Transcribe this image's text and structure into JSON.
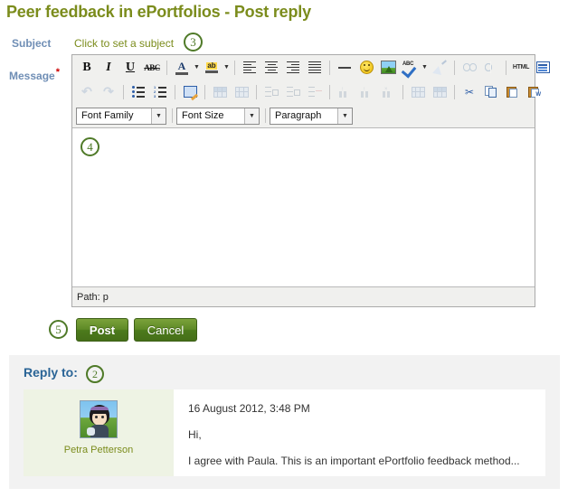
{
  "page": {
    "title": "Peer feedback in ePortfolios - Post reply"
  },
  "form": {
    "subject_label": "Subject",
    "message_label": "Message",
    "required_marker": "*",
    "subject_link": "Click to set a subject"
  },
  "callouts": {
    "subject": "3",
    "editor": "4",
    "buttons": "5",
    "reply": "2"
  },
  "editor": {
    "row1": [
      {
        "name": "bold-icon",
        "glyph": "B"
      },
      {
        "name": "italic-icon",
        "glyph": "I"
      },
      {
        "name": "underline-icon",
        "glyph": "U"
      },
      {
        "name": "strikethrough-icon",
        "glyph": "ABC"
      },
      {
        "name": "text-color-icon",
        "glyph": "A"
      },
      {
        "name": "background-color-icon",
        "glyph": "ab"
      },
      {
        "name": "align-left-icon",
        "glyph": ""
      },
      {
        "name": "align-center-icon",
        "glyph": ""
      },
      {
        "name": "align-right-icon",
        "glyph": ""
      },
      {
        "name": "align-justify-icon",
        "glyph": ""
      },
      {
        "name": "horizontal-rule-icon",
        "glyph": ""
      },
      {
        "name": "emoticon-icon",
        "glyph": ""
      },
      {
        "name": "insert-image-icon",
        "glyph": ""
      },
      {
        "name": "spellcheck-icon",
        "glyph": ""
      },
      {
        "name": "remove-formatting-icon",
        "glyph": ""
      },
      {
        "name": "insert-link-icon",
        "glyph": ""
      },
      {
        "name": "unlink-icon",
        "glyph": ""
      },
      {
        "name": "html-source-icon",
        "glyph": "HTML"
      },
      {
        "name": "toggle-fullscreen-icon",
        "glyph": ""
      }
    ],
    "row2": [
      {
        "name": "undo-icon",
        "glyph": "↶"
      },
      {
        "name": "redo-icon",
        "glyph": "↷"
      },
      {
        "name": "unordered-list-icon",
        "glyph": ""
      },
      {
        "name": "ordered-list-icon",
        "glyph": ""
      },
      {
        "name": "edit-image-icon",
        "glyph": ""
      },
      {
        "name": "insert-row-before-icon",
        "glyph": ""
      },
      {
        "name": "insert-row-after-icon",
        "glyph": ""
      },
      {
        "name": "cell-properties-icon",
        "glyph": ""
      },
      {
        "name": "merge-cells-icon",
        "glyph": ""
      },
      {
        "name": "split-cells-icon",
        "glyph": ""
      },
      {
        "name": "insert-column-before-icon",
        "glyph": ""
      },
      {
        "name": "insert-column-after-icon",
        "glyph": ""
      },
      {
        "name": "delete-column-icon",
        "glyph": ""
      },
      {
        "name": "insert-table-icon",
        "glyph": ""
      },
      {
        "name": "table-properties-icon",
        "glyph": ""
      },
      {
        "name": "cut-icon",
        "glyph": "✂"
      },
      {
        "name": "copy-icon",
        "glyph": ""
      },
      {
        "name": "paste-icon",
        "glyph": ""
      },
      {
        "name": "paste-from-word-icon",
        "glyph": ""
      }
    ],
    "selects": {
      "font_family": "Font Family",
      "font_size": "Font Size",
      "paragraph": "Paragraph"
    },
    "content": "",
    "status_path": "Path: p"
  },
  "actions": {
    "post": "Post",
    "cancel": "Cancel"
  },
  "reply_to": {
    "heading": "Reply to:",
    "post": {
      "author": "Petra Petterson",
      "date": "16 August 2012, 3:48 PM",
      "lines": [
        "Hi,",
        "I agree with Paula. This is an important ePortfolio feedback method..."
      ]
    }
  },
  "colors": {
    "title_green": "#7b8c1c",
    "label_blue": "#6f8eb5",
    "callout_green": "#4f7a28",
    "button_green": "#5e8a26",
    "heading_blue": "#2a6496",
    "required_red": "#cc0000"
  }
}
